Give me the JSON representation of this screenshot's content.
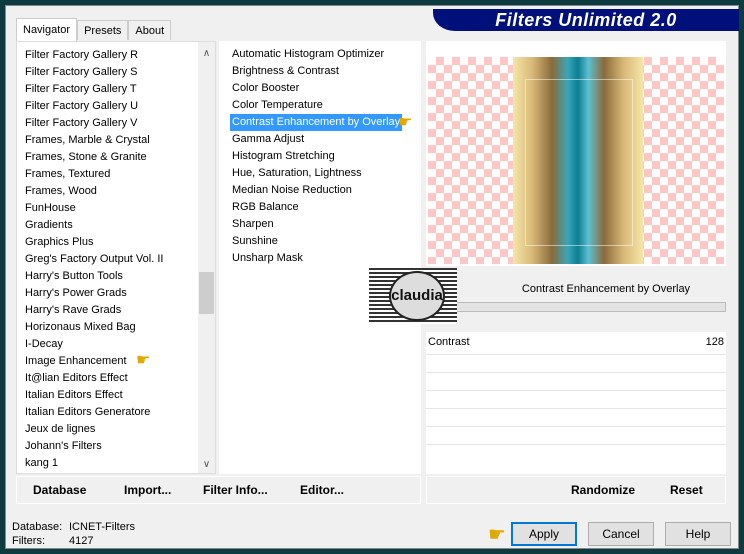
{
  "app_title": "Filters Unlimited 2.0",
  "tabs": [
    "Navigator",
    "Presets",
    "About"
  ],
  "categories": [
    "Filter Factory Gallery R",
    "Filter Factory Gallery S",
    "Filter Factory Gallery T",
    "Filter Factory Gallery U",
    "Filter Factory Gallery V",
    "Frames, Marble & Crystal",
    "Frames, Stone & Granite",
    "Frames, Textured",
    "Frames, Wood",
    "FunHouse",
    "Gradients",
    "Graphics Plus",
    "Greg's Factory Output Vol. II",
    "Harry's Button Tools",
    "Harry's Power Grads",
    "Harry's Rave Grads",
    "Horizonaus Mixed Bag",
    "I-Decay",
    "Image Enhancement",
    "It@lian Editors Effect",
    "Italian Editors Effect",
    "Italian Editors Generatore",
    "Jeux de lignes",
    "Johann's Filters",
    "kang 1"
  ],
  "selected_category": "Image Enhancement",
  "filters": [
    "Automatic Histogram Optimizer",
    "Brightness & Contrast",
    "Color Booster",
    "Color Temperature",
    "Contrast Enhancement by Overlay",
    "Gamma Adjust",
    "Histogram Stretching",
    "Hue, Saturation, Lightness",
    "Median Noise Reduction",
    "RGB Balance",
    "Sharpen",
    "Sunshine",
    "Unsharp Mask"
  ],
  "selected_filter": "Contrast Enhancement by Overlay",
  "control": {
    "title": "Contrast Enhancement by Overlay",
    "param_label": "Contrast",
    "param_value": "128"
  },
  "buttons": {
    "database": "Database",
    "import": "Import...",
    "filter_info": "Filter Info...",
    "editor": "Editor...",
    "randomize": "Randomize",
    "reset": "Reset",
    "apply": "Apply",
    "cancel": "Cancel",
    "help": "Help"
  },
  "status": {
    "database_label": "Database:",
    "database_value": "ICNET-Filters",
    "filters_label": "Filters:",
    "filters_value": "4127"
  },
  "watermark": "claudia",
  "colors": {
    "banner": "#00107a",
    "selection": "#3399ff",
    "default_button_border": "#0078d7"
  }
}
